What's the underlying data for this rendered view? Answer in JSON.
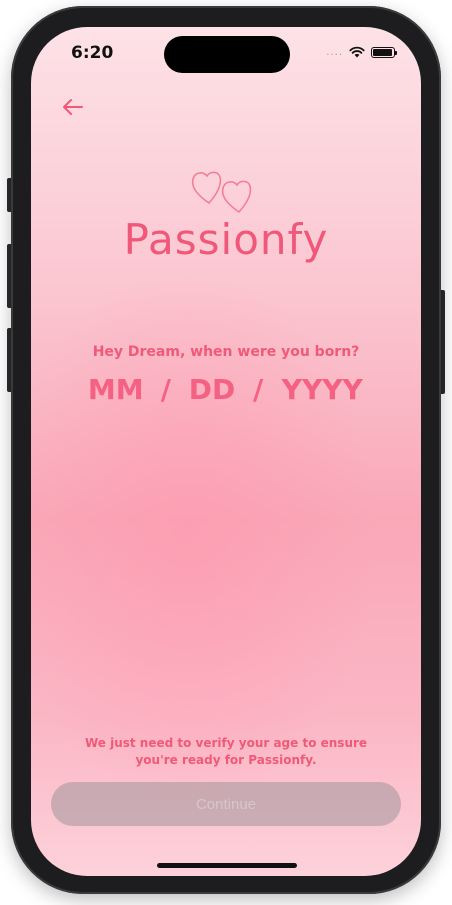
{
  "status_bar": {
    "time": "6:20",
    "signal": "....",
    "wifi_icon": "wifi-icon",
    "battery_icon": "battery-icon"
  },
  "header": {
    "back_icon": "arrow-left-icon"
  },
  "brand": {
    "logo_icon": "hearts-icon",
    "name": "Passionfy"
  },
  "form": {
    "question": "Hey Dream, when were you born?",
    "month_placeholder": "MM",
    "day_placeholder": "DD",
    "year_placeholder": "YYYY",
    "separator": "/"
  },
  "footer": {
    "disclaimer": "We just need to verify your age to ensure you're ready for Passionfy.",
    "continue_label": "Continue"
  },
  "colors": {
    "accent": "#f0587a",
    "button_disabled": "#a09699"
  }
}
